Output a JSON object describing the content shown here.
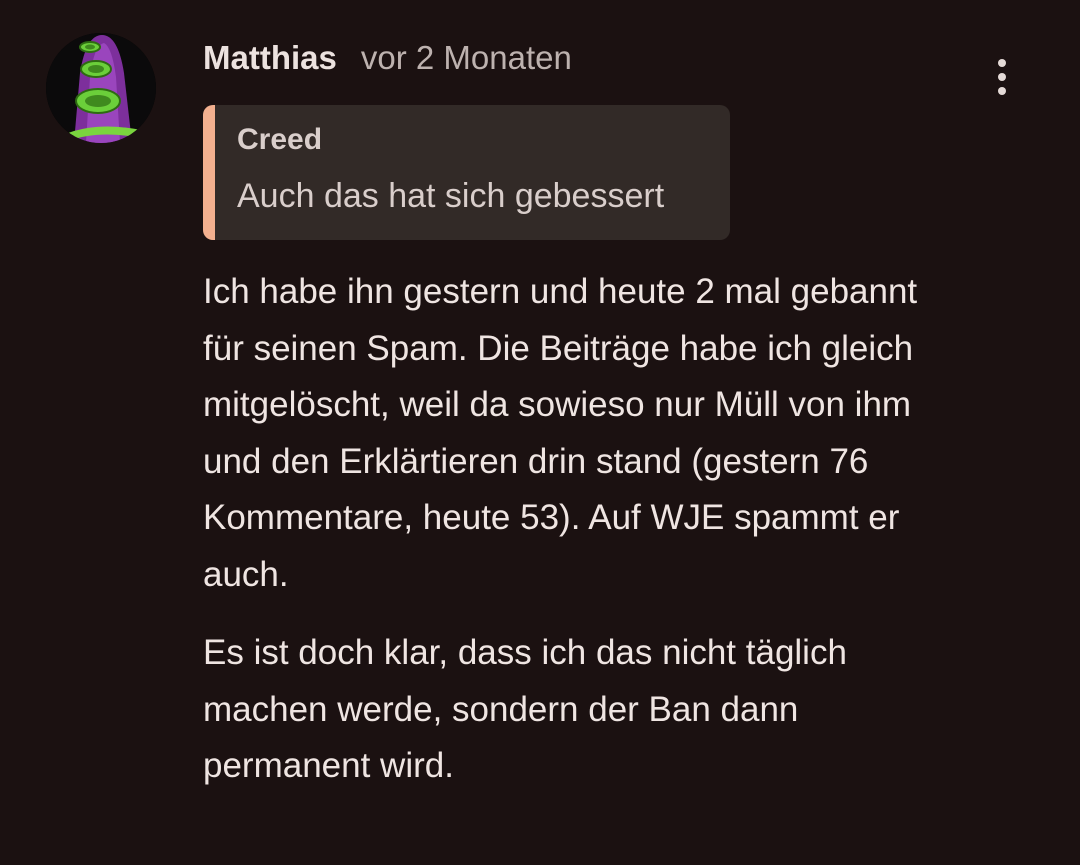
{
  "comment": {
    "author": "Matthias",
    "timestamp": "vor 2 Monaten",
    "quote": {
      "author": "Creed",
      "text": "Auch das hat sich gebessert"
    },
    "paragraphs": [
      "Ich habe ihn gestern und heute 2 mal gebannt für seinen Spam. Die Beiträge habe ich gleich mitgelöscht, weil da sowieso nur Müll von ihm und den Erklärtieren drin stand (gestern 76 Kommentare, heute 53). Auf WJE spammt er auch.",
      "Es ist doch klar, dass ich das nicht täglich machen werde, sondern der Ban dann permanent wird."
    ],
    "menu_icon": "more-vertical-icon"
  },
  "colors": {
    "background": "#1b1111",
    "quote_background": "#322a27",
    "quote_accent": "#f3b08f",
    "text": "#efe5e2",
    "muted_text": "#bdb2af"
  }
}
